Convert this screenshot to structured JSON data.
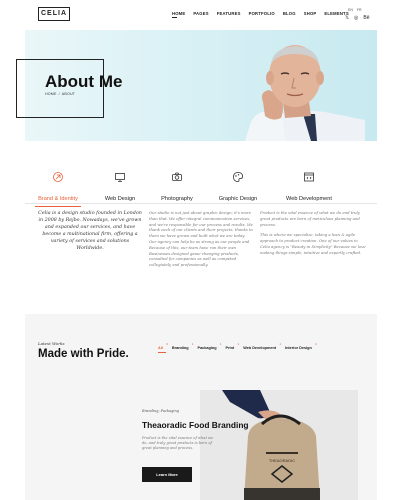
{
  "header": {
    "logo": "CELIA",
    "nav": [
      "HOME",
      "PAGES",
      "FEATURES",
      "PORTFOLIO",
      "BLOG",
      "SHOP",
      "ELEMENTS"
    ],
    "lang": [
      "EN",
      "FR"
    ],
    "socials": [
      "twitter-icon",
      "instagram-icon",
      "behance-icon"
    ],
    "social_glyphs": [
      "𝕏",
      "◎",
      "Bē"
    ]
  },
  "hero": {
    "title": "About Me",
    "breadcrumb_home": "HOME",
    "breadcrumb_sep": "/",
    "breadcrumb_current": "ABOUT"
  },
  "services": [
    {
      "label": "Brand & Identity",
      "icon": "brand-icon",
      "active": true
    },
    {
      "label": "Web Design",
      "icon": "monitor-icon",
      "active": false
    },
    {
      "label": "Photography",
      "icon": "camera-icon",
      "active": false
    },
    {
      "label": "Graphic Design",
      "icon": "palette-icon",
      "active": false
    },
    {
      "label": "Web Development",
      "icon": "code-window-icon",
      "active": false
    }
  ],
  "about": {
    "col1": "Celia is a design studio founded in London in 2008 by Rejbo. Nowadays, we've grown and expanded our services, and have become a multinational firm, offering a variety of services and solutions Worldwide.",
    "col2": "Our studio is not just about graphic design; it's more than that. We offer integral communication services, and we're responsible for our process and results. We thank each of our clients and their projects, thanks to them we have grown and built what we are today. Our agency can help be as strong as our people and Because of this, our team have run their own Businesses designed game-changing products, consulted for companies as well as competed collegiately and professionally.",
    "col3_p1": "Product is the vital essence of what we do and truly great products are born of meticulous planning and process.",
    "col3_p2": "This is where we specialize, taking a lean & agile approach to product creation. One of our values in Celia agency is \"Beauty in Simplicity\" Because we love making things simple, intuitive and expertly crafted."
  },
  "works": {
    "kicker": "Latest Works",
    "title": "Made with Pride.",
    "filters": [
      {
        "label": "All",
        "count": "6",
        "active": true
      },
      {
        "label": "Branding",
        "count": "1",
        "active": false
      },
      {
        "label": "Packaging",
        "count": "1",
        "active": false
      },
      {
        "label": "Print",
        "count": "1",
        "active": false
      },
      {
        "label": "Web Development",
        "count": "1",
        "active": false
      },
      {
        "label": "Interior Design",
        "count": "2",
        "active": false
      }
    ],
    "project": {
      "category": "Branding, Packaging",
      "title": "Theaoradic Food Branding",
      "desc": "Product is the vital essence of what we do, and truly great products is born of great planning and process.",
      "button": "Learn More",
      "box_label": "THEAORADIC"
    }
  },
  "colors": {
    "accent": "#e8603c",
    "dark": "#1a1a1a",
    "hero_bg": "#d9f1f5"
  }
}
